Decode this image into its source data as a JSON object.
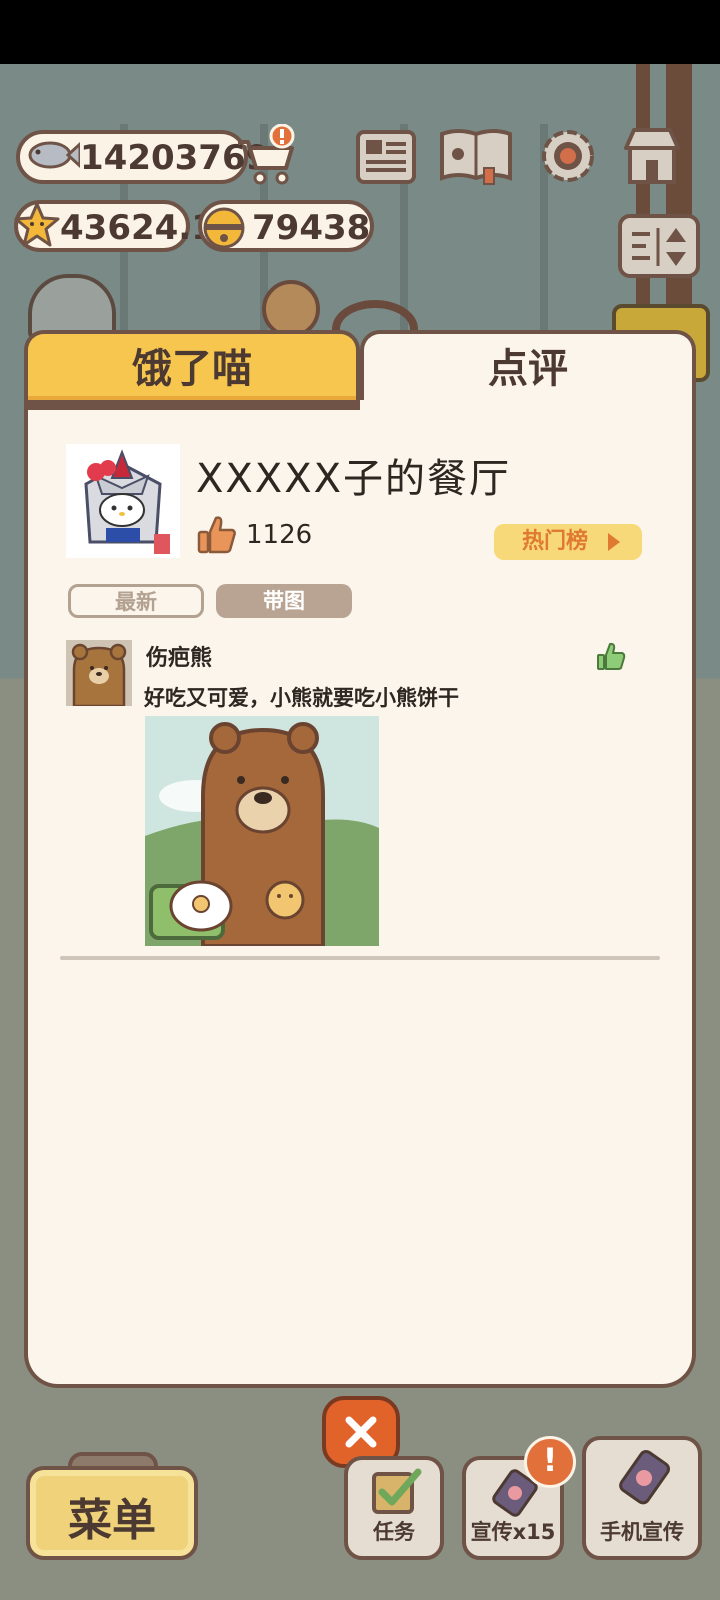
{
  "hud": {
    "fish": "14203769",
    "stars": "43624.1",
    "bells": "79438"
  },
  "tabs": {
    "hungry": "饿了喵",
    "review": "点评"
  },
  "restaurant": {
    "name": "XXXXX子的餐厅",
    "likes": "1126",
    "hot_list": "热门榜"
  },
  "filters": {
    "newest": "最新",
    "with_image": "带图"
  },
  "review": {
    "author": "伤疤熊",
    "text": "好吃又可爱，小熊就要吃小熊饼干"
  },
  "bottom": {
    "menu": "菜单",
    "task": "任务",
    "promo": "宣传x15",
    "phone_promo": "手机宣传"
  },
  "colors": {
    "accent": "#f7c64e",
    "border": "#6e5346",
    "panel": "#fbf5ec",
    "alert": "#e2703a",
    "like_green": "#7cbf6a",
    "like_orange": "#e9955a"
  }
}
